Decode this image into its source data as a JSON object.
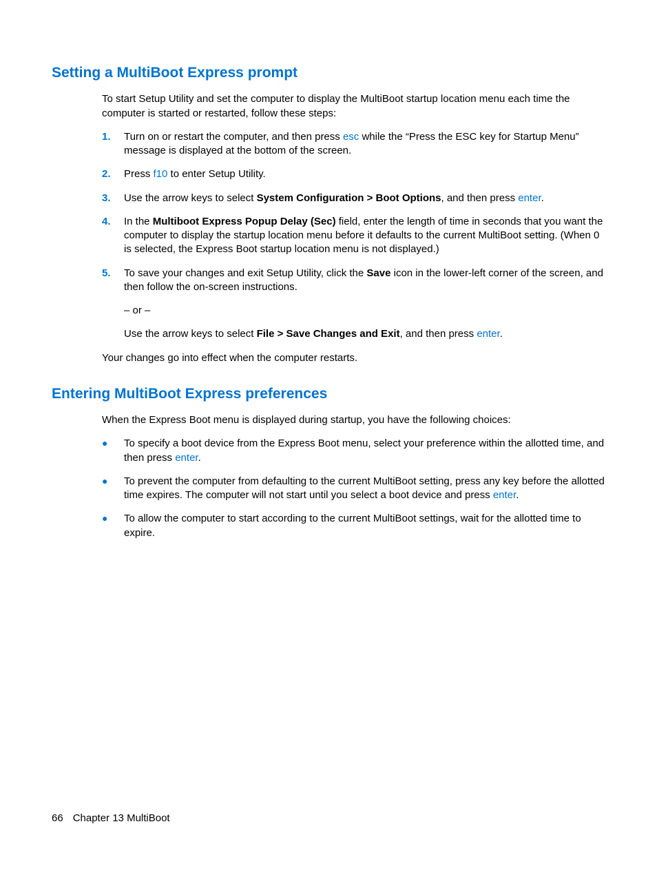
{
  "section1": {
    "heading": "Setting a MultiBoot Express prompt",
    "intro": "To start Setup Utility and set the computer to display the MultiBoot startup location menu each time the computer is started or restarted, follow these steps:",
    "steps": {
      "n1": "1.",
      "s1a": "Turn on or restart the computer, and then press ",
      "s1k": "esc",
      "s1b": " while the “Press the ESC key for Startup Menu” message is displayed at the bottom of the screen.",
      "n2": "2.",
      "s2a": "Press ",
      "s2k": "f10",
      "s2b": " to enter Setup Utility.",
      "n3": "3.",
      "s3a": "Use the arrow keys to select ",
      "s3b": "System Configuration > Boot Options",
      "s3c": ", and then press ",
      "s3k": "enter",
      "s3d": ".",
      "n4": "4.",
      "s4a": "In the ",
      "s4b": "Multiboot Express Popup Delay (Sec)",
      "s4c": " field, enter the length of time in seconds that you want the computer to display the startup location menu before it defaults to the current MultiBoot setting. (When 0 is selected, the Express Boot startup location menu is not displayed.)",
      "n5": "5.",
      "s5a": "To save your changes and exit Setup Utility, click the ",
      "s5b": "Save",
      "s5c": " icon in the lower-left corner of the screen, and then follow the on-screen instructions.",
      "s5or": "– or –",
      "s5d": "Use the arrow keys to select ",
      "s5e": "File > Save Changes and Exit",
      "s5f": ", and then press ",
      "s5k": "enter",
      "s5g": "."
    },
    "outro": "Your changes go into effect when the computer restarts."
  },
  "section2": {
    "heading": "Entering MultiBoot Express preferences",
    "intro": "When the Express Boot menu is displayed during startup, you have the following choices:",
    "bullets": {
      "dot": "●",
      "b1a": "To specify a boot device from the Express Boot menu, select your preference within the allotted time, and then press ",
      "b1k": "enter",
      "b1b": ".",
      "b2a": "To prevent the computer from defaulting to the current MultiBoot setting, press any key before the allotted time expires. The computer will not start until you select a boot device and press ",
      "b2k": "enter",
      "b2b": ".",
      "b3": "To allow the computer to start according to the current MultiBoot settings, wait for the allotted time to expire."
    }
  },
  "footer": {
    "page": "66",
    "chapter": "Chapter 13   MultiBoot"
  }
}
